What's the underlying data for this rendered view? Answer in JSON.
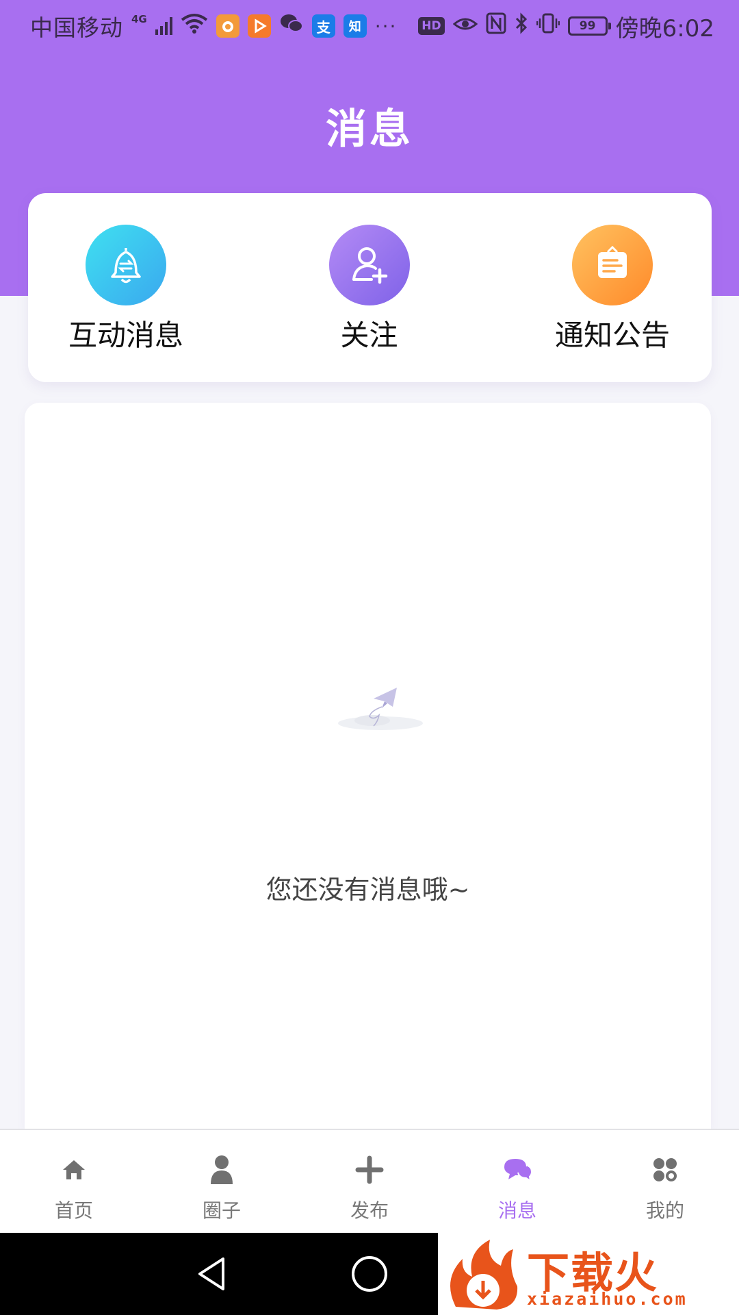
{
  "status_bar": {
    "carrier": "中国移动",
    "network": "4G",
    "app_icons": [
      "uc-browser-icon",
      "video-app-icon",
      "wechat-icon",
      "alipay-icon",
      "zhihu-icon"
    ],
    "alipay_glyph": "支",
    "zhihu_glyph": "知",
    "more": "···",
    "hd": "HD",
    "battery": "99",
    "time": "傍晚6:02"
  },
  "header": {
    "title": "消息"
  },
  "quick_entries": [
    {
      "label": "互动消息",
      "icon": "bell-icon"
    },
    {
      "label": "关注",
      "icon": "add-user-icon"
    },
    {
      "label": "通知公告",
      "icon": "notice-board-icon"
    }
  ],
  "empty_state": {
    "text": "您还没有消息哦~",
    "icon": "paper-plane-icon"
  },
  "tab_bar": {
    "active_index": 3,
    "items": [
      {
        "label": "首页",
        "icon": "home-icon"
      },
      {
        "label": "圈子",
        "icon": "person-icon"
      },
      {
        "label": "发布",
        "icon": "plus-icon"
      },
      {
        "label": "消息",
        "icon": "chat-bubble-icon"
      },
      {
        "label": "我的",
        "icon": "grid-icon"
      }
    ]
  },
  "watermark": {
    "text": "下载火",
    "url": "xiazaihuo.com"
  },
  "colors": {
    "brand": "#a86ff0",
    "page_bg": "#f5f5fa",
    "tab_inactive": "#777777",
    "tab_active": "#a86ff0",
    "watermark": "#e8541b"
  }
}
